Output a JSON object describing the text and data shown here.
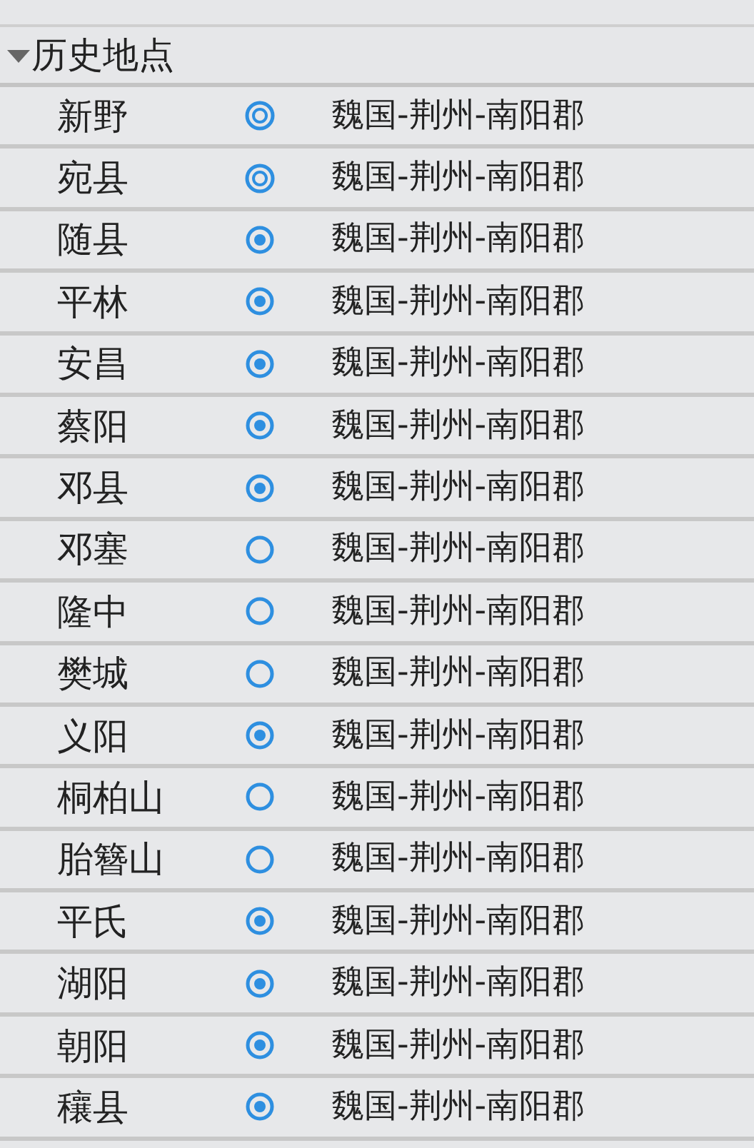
{
  "group": {
    "title": "历史地点",
    "expanded": true,
    "rows": [
      {
        "name": "新野",
        "kind": "city",
        "region": "魏国-荆州-南阳郡"
      },
      {
        "name": "宛县",
        "kind": "city",
        "region": "魏国-荆州-南阳郡"
      },
      {
        "name": "随县",
        "kind": "town",
        "region": "魏国-荆州-南阳郡"
      },
      {
        "name": "平林",
        "kind": "town",
        "region": "魏国-荆州-南阳郡"
      },
      {
        "name": "安昌",
        "kind": "town",
        "region": "魏国-荆州-南阳郡"
      },
      {
        "name": "蔡阳",
        "kind": "town",
        "region": "魏国-荆州-南阳郡"
      },
      {
        "name": "邓县",
        "kind": "town",
        "region": "魏国-荆州-南阳郡"
      },
      {
        "name": "邓塞",
        "kind": "site",
        "region": "魏国-荆州-南阳郡"
      },
      {
        "name": "隆中",
        "kind": "site",
        "region": "魏国-荆州-南阳郡"
      },
      {
        "name": "樊城",
        "kind": "site",
        "region": "魏国-荆州-南阳郡"
      },
      {
        "name": "义阳",
        "kind": "town",
        "region": "魏国-荆州-南阳郡"
      },
      {
        "name": "桐柏山",
        "kind": "site",
        "region": "魏国-荆州-南阳郡"
      },
      {
        "name": "胎簪山",
        "kind": "site",
        "region": "魏国-荆州-南阳郡"
      },
      {
        "name": "平氏",
        "kind": "town",
        "region": "魏国-荆州-南阳郡"
      },
      {
        "name": "湖阳",
        "kind": "town",
        "region": "魏国-荆州-南阳郡"
      },
      {
        "name": "朝阳",
        "kind": "town",
        "region": "魏国-荆州-南阳郡"
      },
      {
        "name": "穰县",
        "kind": "town",
        "region": "魏国-荆州-南阳郡"
      }
    ]
  }
}
